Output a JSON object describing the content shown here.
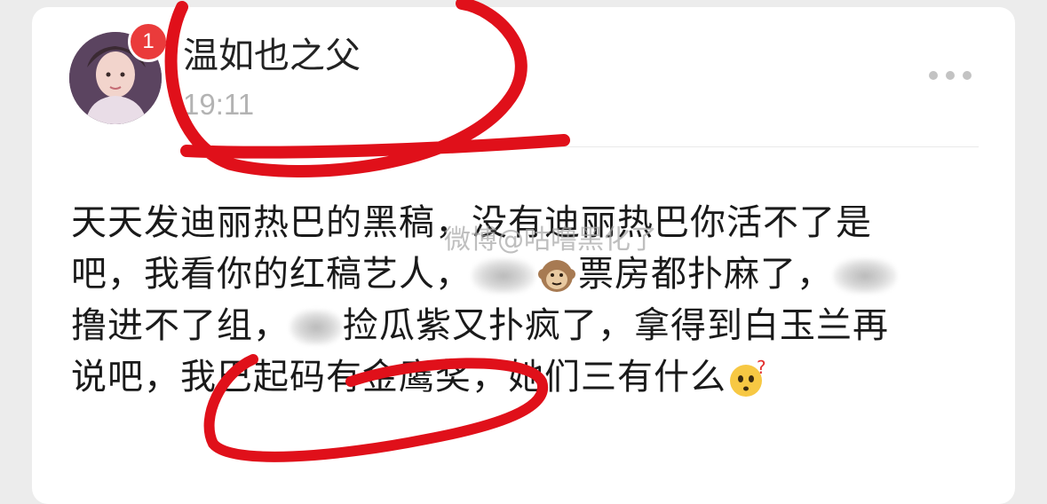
{
  "post": {
    "notification_count": "1",
    "username": "温如也之父",
    "time": "19:11",
    "lines": [
      "天天发迪丽热巴的黑稿，没有迪丽热巴你活不了是",
      [
        "吧，我看你的红稿艺人，",
        "票房都扑麻了，"
      ],
      [
        "撸进不了组，",
        "捡瓜紫又扑疯了，拿得到白玉兰再"
      ],
      [
        "说吧，我巴起码有金鹰奖，她们三有什么",
        ""
      ]
    ],
    "watermark": "微博@咕噜黑化了"
  },
  "icons": {
    "more": "more-dots-icon",
    "monkey": "monkey-emoji-icon",
    "thinking": "thinking-face-emoji-icon"
  },
  "colors": {
    "badge": "#ea3b3b",
    "annotation_red": "#e0101a"
  }
}
